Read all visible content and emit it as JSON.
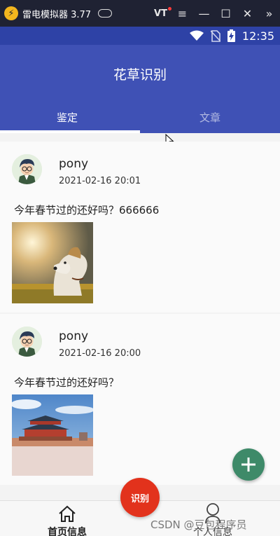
{
  "emulator": {
    "title": "雷电模拟器 3.77",
    "vt_label": "VT"
  },
  "status_bar": {
    "time": "12:35"
  },
  "app_bar": {
    "title": "花草识别",
    "tabs": [
      {
        "label": "鉴定",
        "active": true
      },
      {
        "label": "文章",
        "active": false
      }
    ]
  },
  "posts": [
    {
      "username": "pony",
      "time": "2021-02-16 20:01",
      "text": "今年春节过的还好吗？666666",
      "image": "dog-photo"
    },
    {
      "username": "pony",
      "time": "2021-02-16 20:00",
      "text": "今年春节过的还好吗？",
      "image": "city-gate-photo"
    }
  ],
  "fab": {
    "icon": "plus-icon",
    "color": "#3e8a69"
  },
  "bottom_nav": {
    "home_label": "首页信息",
    "center_label": "识别",
    "me_label": "个人信息"
  },
  "watermark": "CSDN @豆包程序员",
  "colors": {
    "primary": "#3f51b5",
    "status": "#2e42a6",
    "center_button": "#e2321c"
  }
}
